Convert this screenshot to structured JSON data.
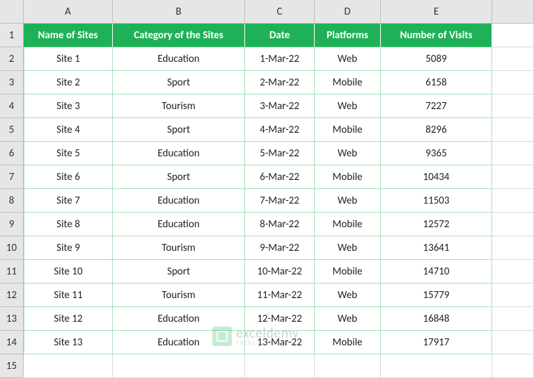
{
  "columns": [
    "A",
    "B",
    "C",
    "D",
    "E",
    ""
  ],
  "rowNumbers": [
    "1",
    "2",
    "3",
    "4",
    "5",
    "6",
    "7",
    "8",
    "9",
    "10",
    "11",
    "12",
    "13",
    "14",
    "15"
  ],
  "headers": {
    "a": "Name of Sites",
    "b": "Category of the Sites",
    "c": "Date",
    "d": "Platforms",
    "e": "Number of Visits"
  },
  "rows": [
    {
      "a": "Site 1",
      "b": "Education",
      "c": "1-Mar-22",
      "d": "Web",
      "e": "5089"
    },
    {
      "a": "Site 2",
      "b": "Sport",
      "c": "2-Mar-22",
      "d": "Mobile",
      "e": "6158"
    },
    {
      "a": "Site 3",
      "b": "Tourism",
      "c": "3-Mar-22",
      "d": "Web",
      "e": "7227"
    },
    {
      "a": "Site 4",
      "b": "Sport",
      "c": "4-Mar-22",
      "d": "Mobile",
      "e": "8296"
    },
    {
      "a": "Site 5",
      "b": "Education",
      "c": "5-Mar-22",
      "d": "Web",
      "e": "9365"
    },
    {
      "a": "Site 6",
      "b": "Sport",
      "c": "6-Mar-22",
      "d": "Mobile",
      "e": "10434"
    },
    {
      "a": "Site 7",
      "b": "Education",
      "c": "7-Mar-22",
      "d": "Web",
      "e": "11503"
    },
    {
      "a": "Site 8",
      "b": "Education",
      "c": "8-Mar-22",
      "d": "Mobile",
      "e": "12572"
    },
    {
      "a": "Site 9",
      "b": "Tourism",
      "c": "9-Mar-22",
      "d": "Web",
      "e": "13641"
    },
    {
      "a": "Site 10",
      "b": "Sport",
      "c": "10-Mar-22",
      "d": "Mobile",
      "e": "14710"
    },
    {
      "a": "Site 11",
      "b": "Tourism",
      "c": "11-Mar-22",
      "d": "Web",
      "e": "15779"
    },
    {
      "a": "Site 12",
      "b": "Education",
      "c": "12-Mar-22",
      "d": "Web",
      "e": "16848"
    },
    {
      "a": "Site 13",
      "b": "Education",
      "c": "13-Mar-22",
      "d": "Mobile",
      "e": "17917"
    }
  ],
  "watermark": {
    "title": "exceldemy",
    "sub": "EXCEL · DATA · BI"
  }
}
